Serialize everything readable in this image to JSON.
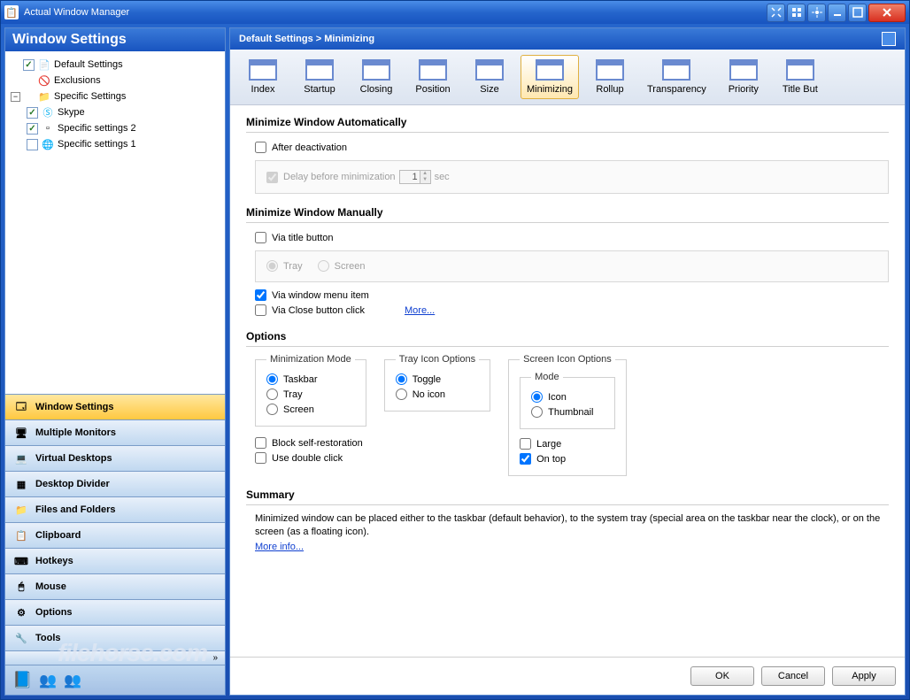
{
  "window": {
    "title": "Actual Window Manager"
  },
  "titlebar_buttons": [
    "expand",
    "grid",
    "divide",
    "minimize",
    "maximize",
    "close"
  ],
  "sidebar": {
    "header": "Window Settings",
    "tree": {
      "root": {
        "label": "Default Settings",
        "checked": true
      },
      "exclusions": {
        "label": "Exclusions"
      },
      "specific": {
        "label": "Specific Settings"
      },
      "items": [
        {
          "label": "Skype",
          "checked": true
        },
        {
          "label": "Specific settings 2",
          "checked": true
        },
        {
          "label": "Specific settings 1",
          "checked": false
        }
      ]
    },
    "nav": [
      {
        "label": "Window Settings",
        "icon": "window-icon",
        "active": true
      },
      {
        "label": "Multiple Monitors",
        "icon": "monitors-icon"
      },
      {
        "label": "Virtual Desktops",
        "icon": "desktop-icon"
      },
      {
        "label": "Desktop Divider",
        "icon": "divider-icon"
      },
      {
        "label": "Files and Folders",
        "icon": "folder-icon"
      },
      {
        "label": "Clipboard",
        "icon": "clipboard-icon"
      },
      {
        "label": "Hotkeys",
        "icon": "keyboard-icon"
      },
      {
        "label": "Mouse",
        "icon": "mouse-icon"
      },
      {
        "label": "Options",
        "icon": "gear-icon"
      },
      {
        "label": "Tools",
        "icon": "tools-icon"
      }
    ],
    "watermark": "filehorse.com"
  },
  "main": {
    "breadcrumb": "Default Settings > Minimizing",
    "tabs": [
      {
        "label": "Index"
      },
      {
        "label": "Startup"
      },
      {
        "label": "Closing"
      },
      {
        "label": "Position"
      },
      {
        "label": "Size"
      },
      {
        "label": "Minimizing",
        "active": true
      },
      {
        "label": "Rollup"
      },
      {
        "label": "Transparency"
      },
      {
        "label": "Priority"
      },
      {
        "label": "Title But"
      }
    ],
    "sect_auto": {
      "title": "Minimize Window Automatically",
      "after_deactivation": "After deactivation",
      "delay_label": "Delay before minimization",
      "delay_val": "1",
      "delay_unit": "sec"
    },
    "sect_manual": {
      "title": "Minimize Window Manually",
      "via_title": "Via title button",
      "tray": "Tray",
      "screen": "Screen",
      "via_menu": "Via window menu item",
      "via_close": "Via Close button click",
      "more": "More..."
    },
    "sect_options": {
      "title": "Options",
      "min_mode_title": "Minimization Mode",
      "min_modes": [
        "Taskbar",
        "Tray",
        "Screen"
      ],
      "tray_title": "Tray Icon Options",
      "tray_opts": [
        "Toggle",
        "No icon"
      ],
      "screen_title": "Screen Icon Options",
      "screen_mode_title": "Mode",
      "screen_modes": [
        "Icon",
        "Thumbnail"
      ],
      "large": "Large",
      "on_top": "On top",
      "block_self": "Block self-restoration",
      "use_dbl": "Use double click"
    },
    "sect_summary": {
      "title": "Summary",
      "text": "Minimized window can be placed either to the taskbar (default behavior), to the system tray (special area on the taskbar near the clock), or on the screen (as a floating icon).",
      "more": "More info..."
    }
  },
  "footer": {
    "ok": "OK",
    "cancel": "Cancel",
    "apply": "Apply"
  }
}
